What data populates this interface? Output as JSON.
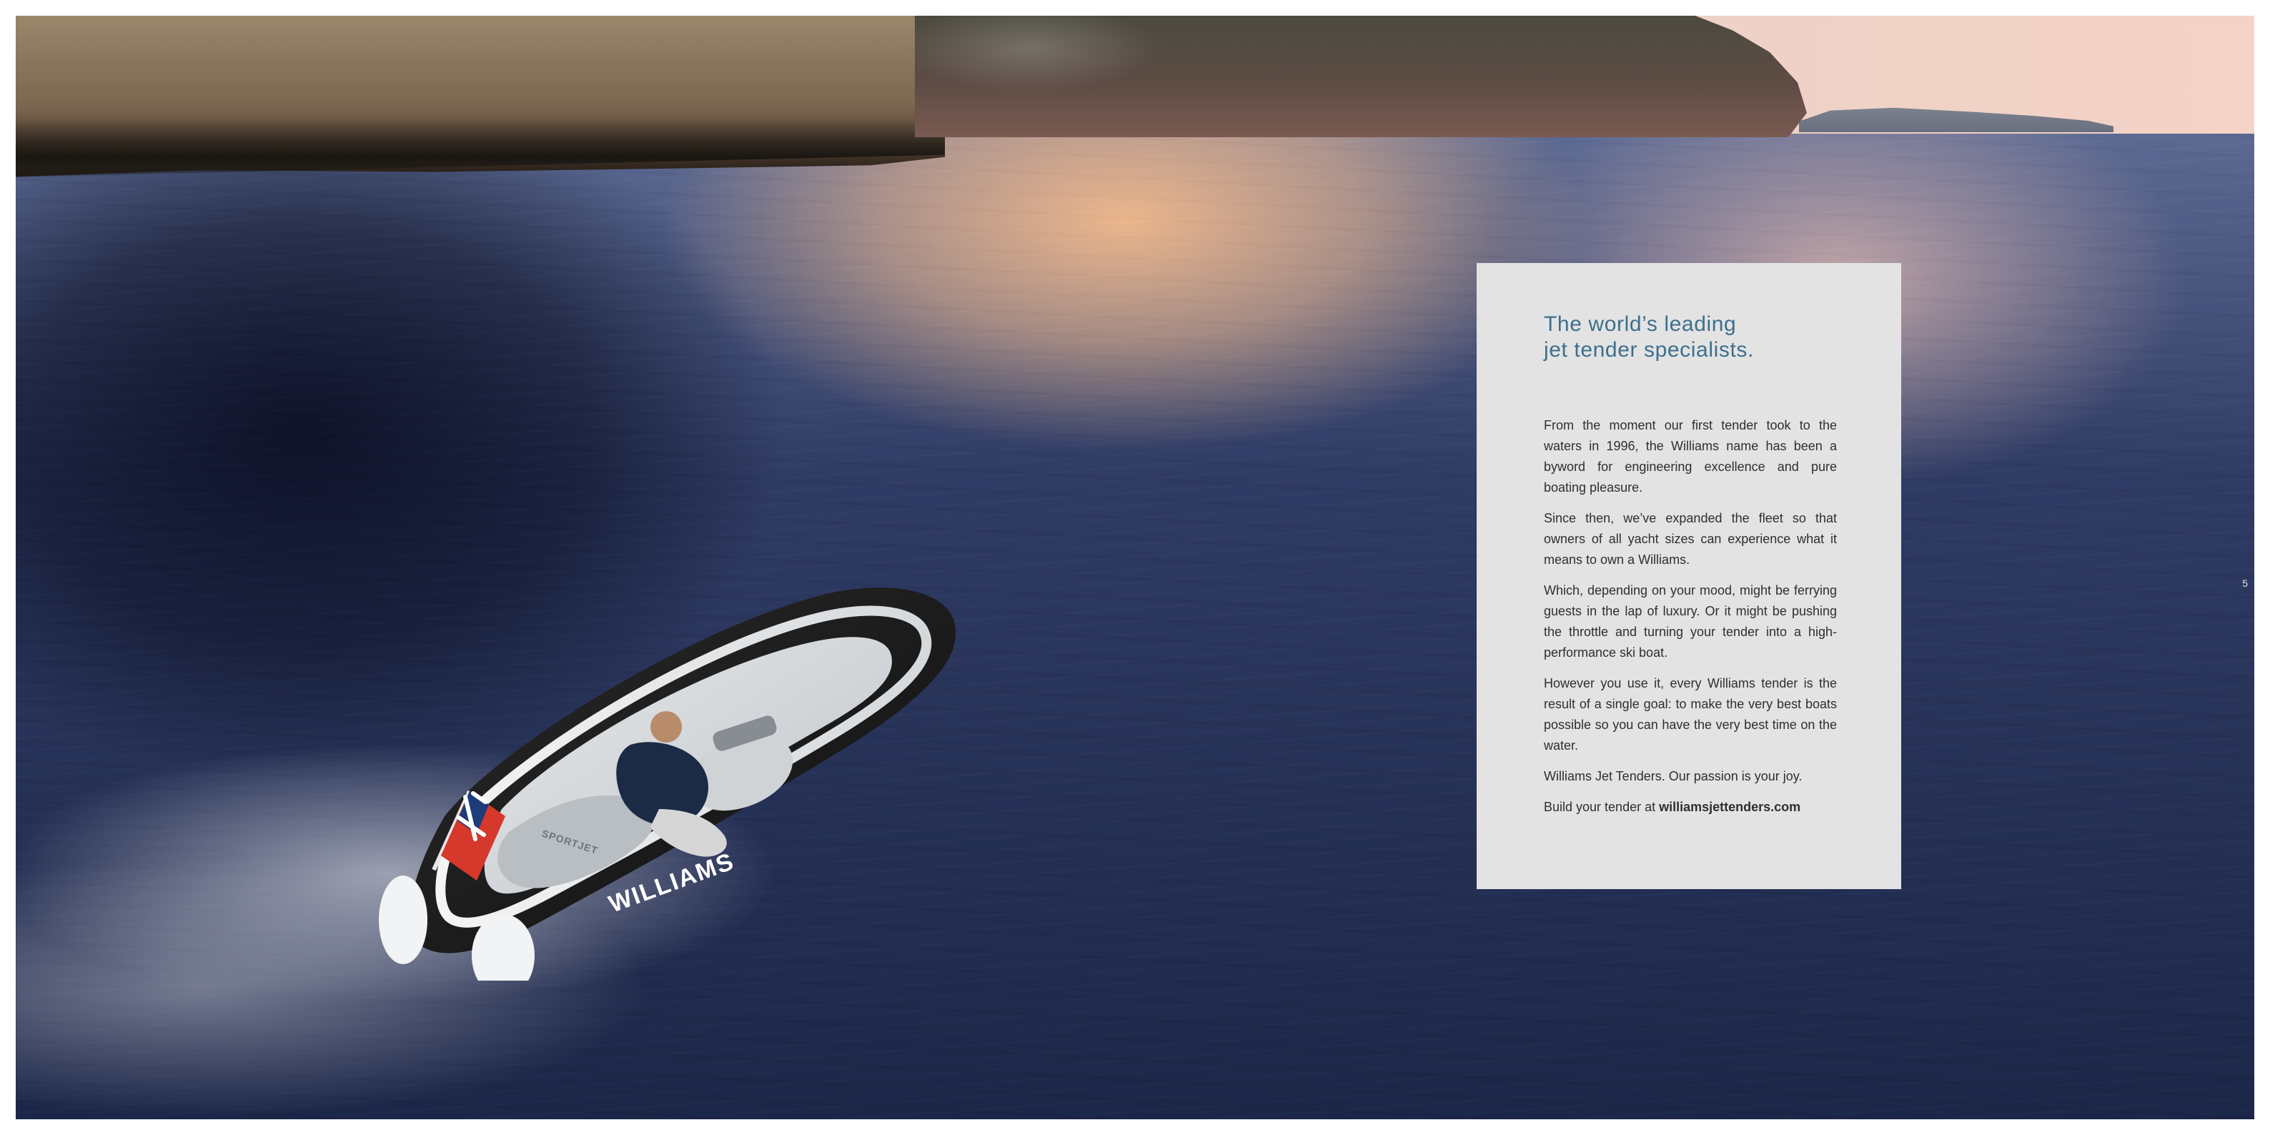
{
  "card": {
    "title_lines": [
      "The world’s leading",
      "jet tender specialists."
    ],
    "paragraphs": [
      "From the moment our first tender took to the waters in 1996, the Williams name has been a byword for engineering excellence and pure boating pleasure.",
      "Since then, we’ve expanded the fleet so that owners of all yacht sizes can experience what it means to own a Williams.",
      "Which, depending on your mood, might be ferrying guests in the lap of luxury. Or it might be pushing the throttle and turning your tender into a high-performance ski boat.",
      "However you use it, every Williams tender is the result of a single goal: to make the very best boats possible so you can have the very best time on the water.",
      "Williams Jet Tenders. Our passion is your joy."
    ],
    "cta_prefix": "Build your tender at ",
    "cta_link": "williamsjettenders.com"
  },
  "boat": {
    "brand_text": "WILLIAMS",
    "seat_text": "SPORTJET"
  },
  "page_number": "5",
  "colors": {
    "card_background": "#e3e3e4",
    "title_blue": "#3e6f8c",
    "body_text": "#2f2f2f",
    "hull_dark": "#151515",
    "hull_white": "#f3f3f3",
    "flag_red": "#d6382b"
  }
}
